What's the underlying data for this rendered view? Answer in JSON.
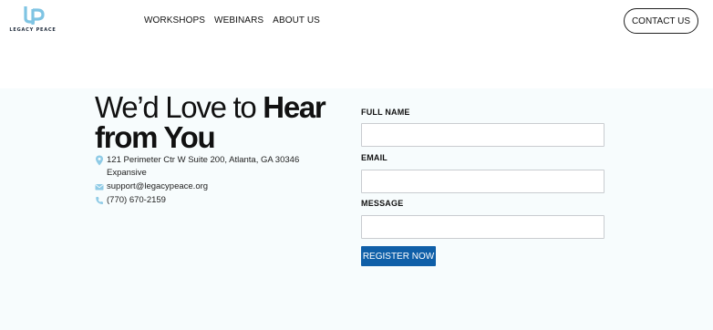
{
  "brand": {
    "name": "LEGACY PEACE",
    "logo_icon": "lp-monogram-icon",
    "color": "#7fc4e3"
  },
  "nav": {
    "items": [
      {
        "label": "WORKSHOPS"
      },
      {
        "label": "WEBINARS"
      },
      {
        "label": "ABOUT US"
      }
    ]
  },
  "header": {
    "contact_label": "CONTACT US"
  },
  "contact": {
    "heading_light": "We’d Love to ",
    "heading_bold_1": "Hear",
    "heading_bold_2": "from You",
    "address_line1": "121 Perimeter Ctr W Suite 200, Atlanta, GA 30346",
    "address_line2": "Expansive",
    "email": "support@legacypeace.org",
    "phone": "(770) 670-2159",
    "icon_color": "#8fcbe6"
  },
  "form": {
    "name_label": "FULL NAME",
    "name_value": "",
    "email_label": "EMAIL",
    "email_value": "",
    "message_label": "MESSAGE",
    "message_value": "",
    "submit_label": "REGISTER NOW",
    "submit_color": "#0f5fa8"
  }
}
